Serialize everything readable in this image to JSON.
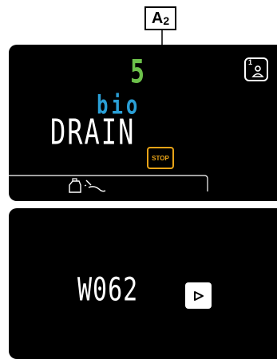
{
  "callout": {
    "letter": "A",
    "index": "2"
  },
  "top_display": {
    "program_number": "5",
    "program_sub": "bio",
    "status_text": "DRAIN",
    "stop_label": "STOP",
    "user_slot": "1"
  },
  "bottom_display": {
    "code": "W062"
  },
  "icons": [
    "callout-leader",
    "stop-button",
    "user-profile-icon",
    "load-dispense-icon",
    "play-icon"
  ],
  "colors": {
    "panel": "#000000",
    "green": "#6cc04a",
    "blue": "#2a9fd6",
    "orange": "#e8a317",
    "white": "#ffffff"
  }
}
